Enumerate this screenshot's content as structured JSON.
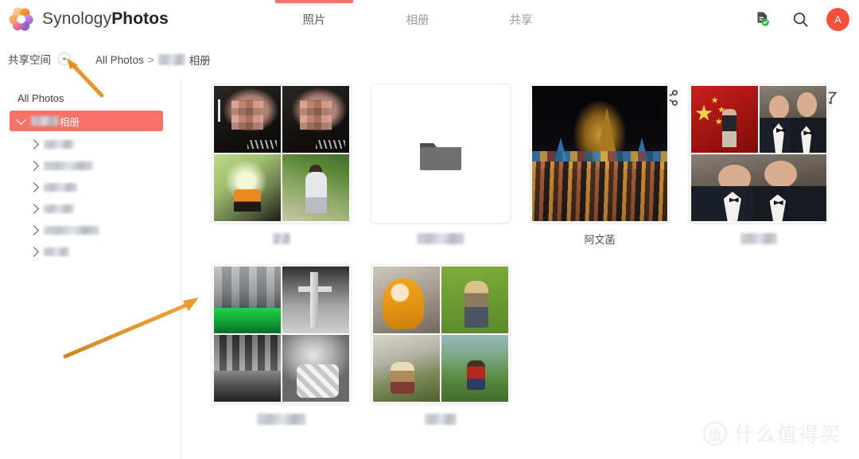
{
  "app": {
    "brand_light": "Synology",
    "brand_bold": "Photos",
    "logo_icon": "synology-flower-logo"
  },
  "header": {
    "tabs": [
      {
        "label": "照片",
        "active": true
      },
      {
        "label": "相册",
        "active": false
      },
      {
        "label": "共享",
        "active": false
      }
    ],
    "actions": [
      {
        "name": "document-check-icon",
        "label": ""
      },
      {
        "name": "search-icon",
        "label": ""
      }
    ],
    "avatar_initial": "A"
  },
  "subbar": {
    "space_label": "共享空间",
    "space_caret_icon": "chevron-down-icon",
    "breadcrumb": {
      "root": "All Photos",
      "separator": ">",
      "current_suffix": "相册",
      "current_blurred": true
    },
    "toolbar": [
      {
        "name": "select-photos-icon",
        "disabled": false
      },
      {
        "name": "add-icon",
        "disabled": false
      },
      {
        "name": "new-folder-icon",
        "disabled": false
      },
      {
        "name": "share-icon",
        "disabled": false
      },
      {
        "name": "sort-icon",
        "disabled": false
      },
      {
        "name": "slideshow-icon",
        "disabled": true
      },
      {
        "name": "calendar-icon",
        "disabled": false
      },
      {
        "name": "filter-icon",
        "disabled": false
      }
    ]
  },
  "sidebar": {
    "root_label": "All Photos",
    "selected": {
      "label_suffix": "相册",
      "blurred": true,
      "expanded": true
    },
    "children": [
      {
        "blur_width": 38,
        "collapsed": true
      },
      {
        "blur_width": 62,
        "collapsed": true
      },
      {
        "blur_width": 42,
        "collapsed": true
      },
      {
        "blur_width": 38,
        "collapsed": true
      },
      {
        "blur_width": 70,
        "collapsed": true
      },
      {
        "blur_width": 32,
        "collapsed": true
      }
    ]
  },
  "albums": [
    {
      "id": "album-1",
      "label": "",
      "label_blurred": true,
      "label_blur_width": 22,
      "layout": "quad",
      "tiles": [
        "dark-portrait-a",
        "dark-portrait-b",
        "baby-green-jacket",
        "toddler-garden"
      ]
    },
    {
      "id": "album-2",
      "label": "",
      "label_blurred": true,
      "label_blur_width": 60,
      "layout": "folder",
      "tiles": []
    },
    {
      "id": "album-3",
      "label": "阿文菡",
      "label_blurred": false,
      "label_blur_width": 0,
      "layout": "single",
      "tiles": [
        "temple-night-market"
      ]
    },
    {
      "id": "album-4",
      "label": "",
      "label_blurred": true,
      "label_blur_width": 46,
      "layout": "two-top-one-wide",
      "tiles": [
        "flag-portrait",
        "tuxedo-pair-a",
        "tuxedo-pair-wide"
      ]
    },
    {
      "id": "album-5",
      "label": "",
      "label_blurred": true,
      "label_blur_width": 62,
      "layout": "quad",
      "tiles": [
        "bw-street-green",
        "bw-pole",
        "bw-city",
        "bw-baby-seat"
      ]
    },
    {
      "id": "album-6",
      "label": "",
      "label_blurred": true,
      "label_blur_width": 40,
      "layout": "quad",
      "tiles": [
        "kid-yellow-hood",
        "kid-grass",
        "kid-path-hat",
        "kid-red-sweater"
      ]
    }
  ],
  "annotations": [
    {
      "name": "arrow-to-space-selector",
      "color": "#E3901F"
    },
    {
      "name": "arrow-to-album-grid",
      "color": "#E3901F"
    }
  ],
  "watermark": {
    "mark": "值",
    "text": "什么值得买"
  },
  "colors": {
    "accent": "#F7736A",
    "tab_indicator": "#EF7566",
    "avatar": "#F4503C",
    "annotation": "#E3901F",
    "sidebar_border": "#ECECEC"
  }
}
